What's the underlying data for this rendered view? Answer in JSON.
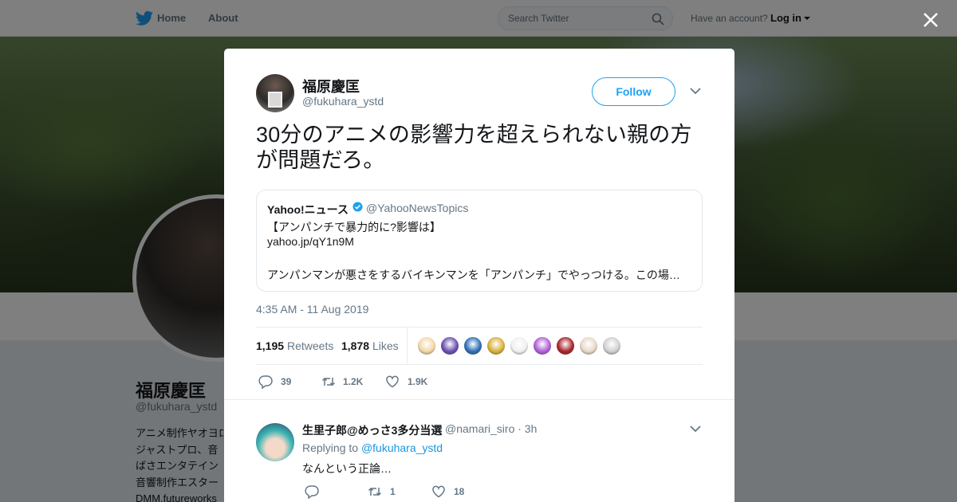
{
  "nav": {
    "home_label": "Home",
    "about_label": "About",
    "search_placeholder": "Search Twitter",
    "account_prompt": "Have an account?",
    "login_label": "Log in",
    "brand_color": "#1da1f2"
  },
  "profile_bg": {
    "name": "福原慶匡",
    "handle": "@fukuhara_ystd",
    "bio_lines": [
      "アニメ制作ヤオヨロズ",
      "ジャストプロ、音",
      "ばさエンタテイン",
      "音響制作エスター",
      "DMM.futureworks"
    ]
  },
  "tweet": {
    "author_name": "福原慶匡",
    "author_handle": "@fukuhara_ystd",
    "follow_label": "Follow",
    "text": "30分のアニメの影響力を超えられない親の方が問題だろ。",
    "quote": {
      "name": "Yahoo!ニュース",
      "handle": "@YahooNewsTopics",
      "line1": "【アンパンチで暴力的に?影響は】",
      "line2": "yahoo.jp/qY1n9M",
      "line3": "アンパンマンが悪さをするバイキンマンを「アンパンチ」でやっつける。この場面について、幼児への影響を心配する声がある"
    },
    "timestamp": "4:35 AM - 11 Aug 2019",
    "retweets_count": "1,195",
    "retweets_label": "Retweets",
    "likes_count": "1,878",
    "likes_label": "Likes",
    "replies_short": "39",
    "retweets_short": "1.2K",
    "likes_short": "1.9K",
    "liker_colors": [
      "#f3d8a8",
      "#6a4fb0",
      "#2f6fb5",
      "#d8b13a",
      "#f0f0f0",
      "#b05fd8",
      "#a8242a",
      "#e8d8c8",
      "#d0d0d0"
    ]
  },
  "reply": {
    "name": "生里子郎@めっさ3多分当選",
    "handle_time": "@namari_siro · 3h",
    "replying_prefix": "Replying to",
    "replying_to": "@fukuhara_ystd",
    "text": "なんという正論…",
    "retweets": "1",
    "likes": "18"
  }
}
